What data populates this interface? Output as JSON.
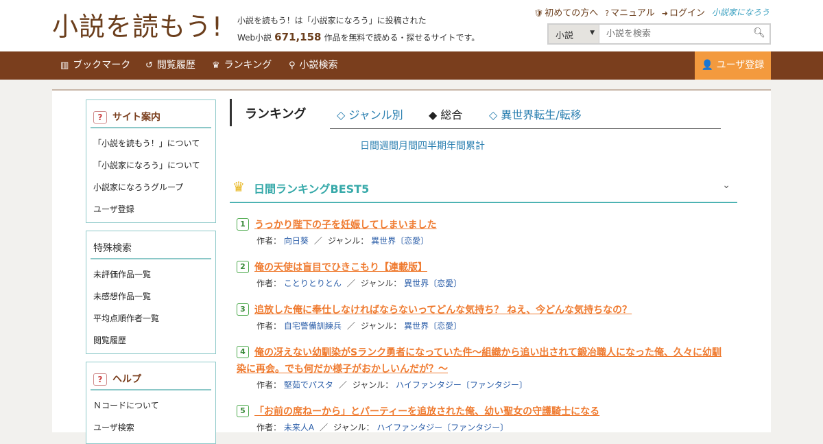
{
  "header": {
    "logo": "小説を読もう!",
    "tagline_line1": "小説を読もう！は「小説家になろう」に投稿された",
    "tagline_prefix": "Web小説",
    "work_count": "671,158",
    "tagline_suffix": "作品を無料で読める・探せるサイトです。",
    "links": [
      {
        "icon": "shield-icon",
        "label": "初めての方へ"
      },
      {
        "icon": "help-circle-icon",
        "label": "マニュアル"
      },
      {
        "icon": "login-icon",
        "label": "ログイン"
      }
    ],
    "partner_logo": "小説家になろう",
    "search": {
      "category": "小説",
      "placeholder": "小説を検索"
    }
  },
  "nav": {
    "items": [
      {
        "icon": "bookmark-icon",
        "label": "ブックマーク"
      },
      {
        "icon": "history-icon",
        "label": "閲覧履歴"
      },
      {
        "icon": "crown-icon",
        "label": "ランキング"
      },
      {
        "icon": "search-icon",
        "label": "小説検索"
      }
    ],
    "register": "ユーザ登録"
  },
  "sidebar": {
    "site_guide": {
      "title": "サイト案内",
      "items": [
        "「小説を読もう！」について",
        "「小説家になろう」について",
        "小説家になろうグループ",
        "ユーザ登録"
      ]
    },
    "special": {
      "title": "特殊検索",
      "items": [
        "未評価作品一覧",
        "未感想作品一覧",
        "平均点順作者一覧",
        "閲覧履歴"
      ]
    },
    "help": {
      "title": "ヘルプ",
      "items": [
        "Ｎコードについて",
        "ユーザ検索"
      ]
    }
  },
  "ranking": {
    "label": "ランキング",
    "tabs": [
      "◇ ジャンル別",
      "◆ 総合",
      "◇ 異世界転生/転移"
    ],
    "periods": [
      "日間",
      "週間",
      "月間",
      "四半期",
      "年間",
      "累計"
    ],
    "best_title": "日間ランキングBEST5",
    "author_label": "作者：",
    "genre_label": "ジャンル：",
    "entries": [
      {
        "rank": "1",
        "title": "うっかり陛下の子を妊娠してしまいました",
        "author": "向日葵",
        "genre": "異世界〔恋愛〕"
      },
      {
        "rank": "2",
        "title": "俺の天使は盲目でひきこもり【連載版】",
        "author": "ことりとりとん",
        "genre": "異世界〔恋愛〕"
      },
      {
        "rank": "3",
        "title": "追放した俺に奉仕しなければならないってどんな気持ち？ ねえ、今どんな気持ちなの？",
        "author": "自宅警備訓練兵",
        "genre": "異世界〔恋愛〕"
      },
      {
        "rank": "4",
        "title": "俺の冴えない幼馴染がSランク勇者になっていた件～組織から追い出されて鍛冶職人になった俺、久々に幼馴染に再会。でも何だか様子がおかしいんだが？～",
        "author": "堅茹でパスタ",
        "genre": "ハイファンタジー〔ファンタジー〕"
      },
      {
        "rank": "5",
        "title": "「お前の席ねーから」とパーティーを追放された俺、幼い聖女の守護騎士になる",
        "author": "未来人A",
        "genre": "ハイファンタジー〔ファンタジー〕"
      }
    ]
  }
}
